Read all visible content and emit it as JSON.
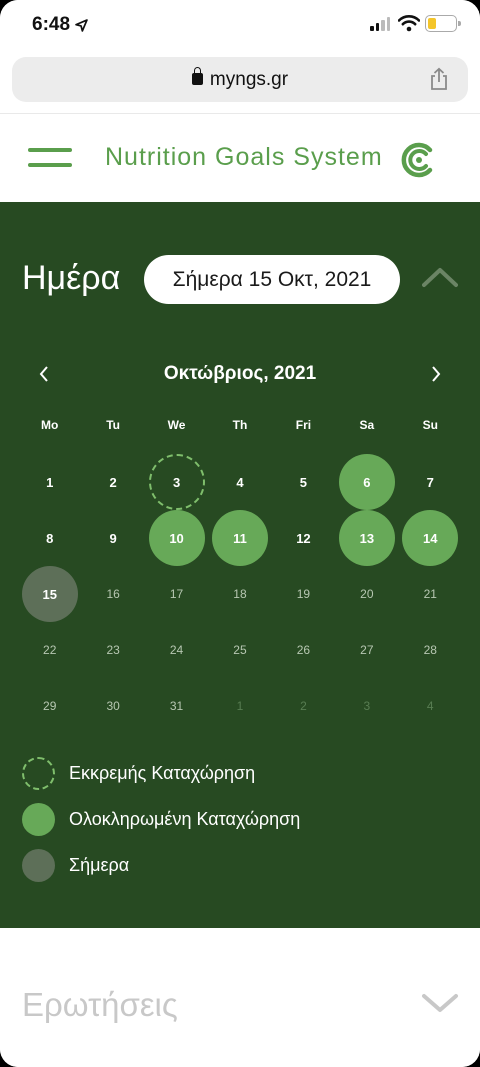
{
  "status_bar": {
    "time": "6:48"
  },
  "browser": {
    "url": "myngs.gr"
  },
  "header": {
    "brand": "Nutrition Goals System"
  },
  "day_section": {
    "title": "Ημέρα",
    "date_pill": "Σήμερα 15 Οκτ, 2021"
  },
  "calendar": {
    "month_label": "Οκτώβριος, 2021",
    "weekdays": [
      "Mo",
      "Tu",
      "We",
      "Th",
      "Fri",
      "Sa",
      "Su"
    ],
    "days": [
      {
        "n": "1",
        "state": "normal"
      },
      {
        "n": "2",
        "state": "normal"
      },
      {
        "n": "3",
        "state": "pending"
      },
      {
        "n": "4",
        "state": "normal"
      },
      {
        "n": "5",
        "state": "normal"
      },
      {
        "n": "6",
        "state": "done"
      },
      {
        "n": "7",
        "state": "normal"
      },
      {
        "n": "8",
        "state": "normal"
      },
      {
        "n": "9",
        "state": "normal"
      },
      {
        "n": "10",
        "state": "done"
      },
      {
        "n": "11",
        "state": "done"
      },
      {
        "n": "12",
        "state": "normal"
      },
      {
        "n": "13",
        "state": "done"
      },
      {
        "n": "14",
        "state": "done"
      },
      {
        "n": "15",
        "state": "today"
      },
      {
        "n": "16",
        "state": "dim"
      },
      {
        "n": "17",
        "state": "dim"
      },
      {
        "n": "18",
        "state": "dim"
      },
      {
        "n": "19",
        "state": "dim"
      },
      {
        "n": "20",
        "state": "dim"
      },
      {
        "n": "21",
        "state": "dim"
      },
      {
        "n": "22",
        "state": "dim"
      },
      {
        "n": "23",
        "state": "dim"
      },
      {
        "n": "24",
        "state": "dim"
      },
      {
        "n": "25",
        "state": "dim"
      },
      {
        "n": "26",
        "state": "dim"
      },
      {
        "n": "27",
        "state": "dim"
      },
      {
        "n": "28",
        "state": "dim"
      },
      {
        "n": "29",
        "state": "dim"
      },
      {
        "n": "30",
        "state": "dim"
      },
      {
        "n": "31",
        "state": "dim"
      },
      {
        "n": "1",
        "state": "out"
      },
      {
        "n": "2",
        "state": "out"
      },
      {
        "n": "3",
        "state": "out"
      },
      {
        "n": "4",
        "state": "out"
      }
    ]
  },
  "legend": {
    "pending": "Εκκρεμής Καταχώρηση",
    "completed": "Ολοκληρωμένη Καταχώρηση",
    "today": "Σήμερα"
  },
  "faq": {
    "title": "Ερωτήσεις"
  },
  "colors": {
    "brand_green": "#5a9e4c",
    "panel_green": "#274a22",
    "completed": "#67a958",
    "today": "#5d6f58"
  }
}
